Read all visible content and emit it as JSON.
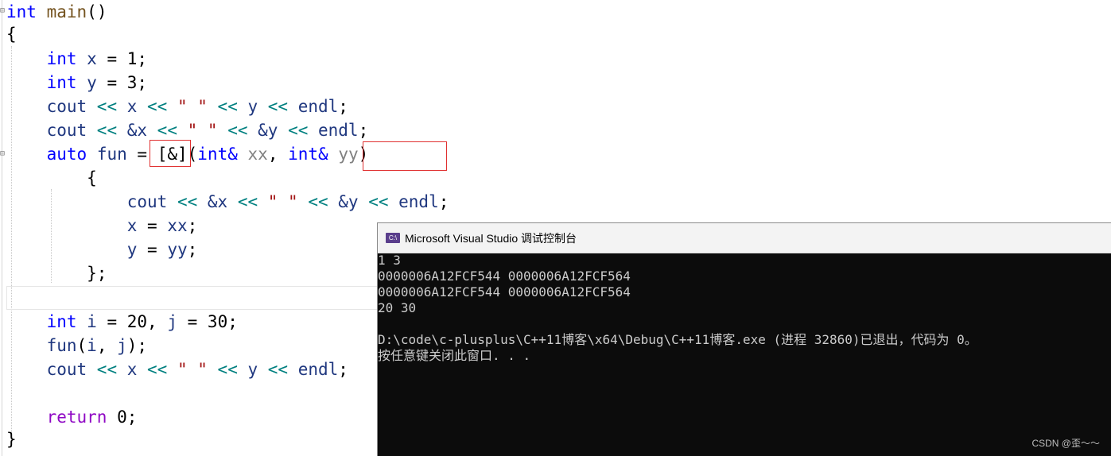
{
  "editor": {
    "lines": {
      "l1": {
        "kw": "int",
        "fn": "main",
        "rest": "()"
      },
      "l2": "{",
      "l3": {
        "kw": "int",
        "var": "x",
        "rest": " = 1;"
      },
      "l4": {
        "kw": "int",
        "var": "y",
        "rest": " = 3;"
      },
      "l5": {
        "a": "cout",
        "b": " << ",
        "c": "x",
        "d": " << ",
        "e": "\" \"",
        "f": " << ",
        "g": "y",
        "h": " << ",
        "i": "endl",
        "j": ";"
      },
      "l6": {
        "a": "cout",
        "b": " << ",
        "c": "&x",
        "d": " << ",
        "e": "\" \"",
        "f": " << ",
        "g": "&y",
        "h": " << ",
        "i": "endl",
        "j": ";"
      },
      "l7": {
        "kw": "auto",
        "var": "fun",
        "eq": " = ",
        "cap": "[&]",
        "open": "(",
        "t1": "int&",
        "p1": "xx",
        "comma": ", ",
        "t2": "int&",
        "p2": "yy",
        "close": ")"
      },
      "l8": "{",
      "l9": {
        "a": "cout",
        "b": " << ",
        "c": "&x",
        "d": " << ",
        "e": "\" \"",
        "f": " << ",
        "g": "&y",
        "h": " << ",
        "i": "endl",
        "j": ";"
      },
      "l10": {
        "var": "x",
        "eq": " = ",
        "val": "xx",
        "semi": ";"
      },
      "l11": {
        "var": "y",
        "eq": " = ",
        "val": "yy",
        "semi": ";"
      },
      "l12": "};",
      "l14": {
        "kw": "int",
        "rest1": " ",
        "v1": "i",
        "rest2": " = 20, ",
        "v2": "j",
        "rest3": " = 30;"
      },
      "l15": {
        "fn": "fun",
        "rest1": "(",
        "v1": "i",
        "rest2": ", ",
        "v2": "j",
        "rest3": ");"
      },
      "l16": {
        "a": "cout",
        "b": " << ",
        "c": "x",
        "d": " << ",
        "e": "\" \"",
        "f": " << ",
        "g": "y",
        "h": " << ",
        "i": "endl",
        "j": ";"
      },
      "l18": {
        "kw": "return",
        "rest": " 0;"
      },
      "l19": "}"
    }
  },
  "console": {
    "icon_label": "C:\\",
    "title": "Microsoft Visual Studio 调试控制台",
    "output": [
      "1 3",
      "0000006A12FCF544 0000006A12FCF564",
      "0000006A12FCF544 0000006A12FCF564",
      "20 30",
      "",
      "D:\\code\\c-plusplus\\C++11博客\\x64\\Debug\\C++11博客.exe (进程 32860)已退出，代码为 0。",
      "按任意键关闭此窗口. . ."
    ]
  },
  "watermark": "CSDN @歪～～",
  "colors": {
    "keyword": "#0000ff",
    "return_keyword": "#8f08c4",
    "function": "#74531f",
    "variable": "#1f377f",
    "parameter": "#808080",
    "string": "#a31515",
    "operator": "#008080",
    "highlight_box": "#e03030",
    "console_bg": "#0c0c0c"
  }
}
